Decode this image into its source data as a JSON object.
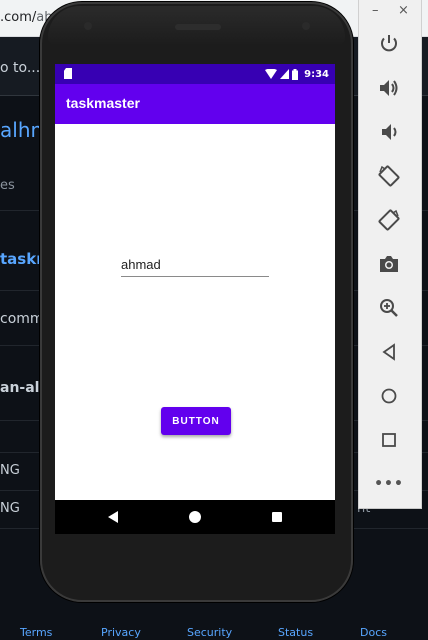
{
  "browser": {
    "url_prefix": ".com/",
    "url_rest": "ab",
    "goto_text": "o to..."
  },
  "github": {
    "user": "alhm",
    "files": "es",
    "repo": "taskm",
    "commit": "commi",
    "branch": "an-alh",
    "row1": "NG",
    "row2": "NG",
    "row2_tail": "nt",
    "footer": {
      "terms": "Terms",
      "privacy": "Privacy",
      "security": "Security",
      "status": "Status",
      "docs": "Docs"
    }
  },
  "device": {
    "status_bar": {
      "time": "9:34"
    },
    "app": {
      "title": "taskmaster",
      "text_field_value": "ahmad",
      "button_label": "BUTTON"
    }
  },
  "emulator_panel": {
    "minimize": "–",
    "close": "×",
    "tools": [
      "power-icon",
      "volume-up-icon",
      "volume-down-icon",
      "rotate-left-icon",
      "rotate-right-icon",
      "screenshot-icon",
      "zoom-icon",
      "back-icon",
      "home-icon",
      "overview-icon",
      "more-icon"
    ],
    "more_label": "•••"
  },
  "colors": {
    "status_bar": "#3700b3",
    "app_bar": "#6200ee",
    "button": "#6200ee",
    "github_bg": "#0d1117",
    "link": "#58a6ff"
  }
}
